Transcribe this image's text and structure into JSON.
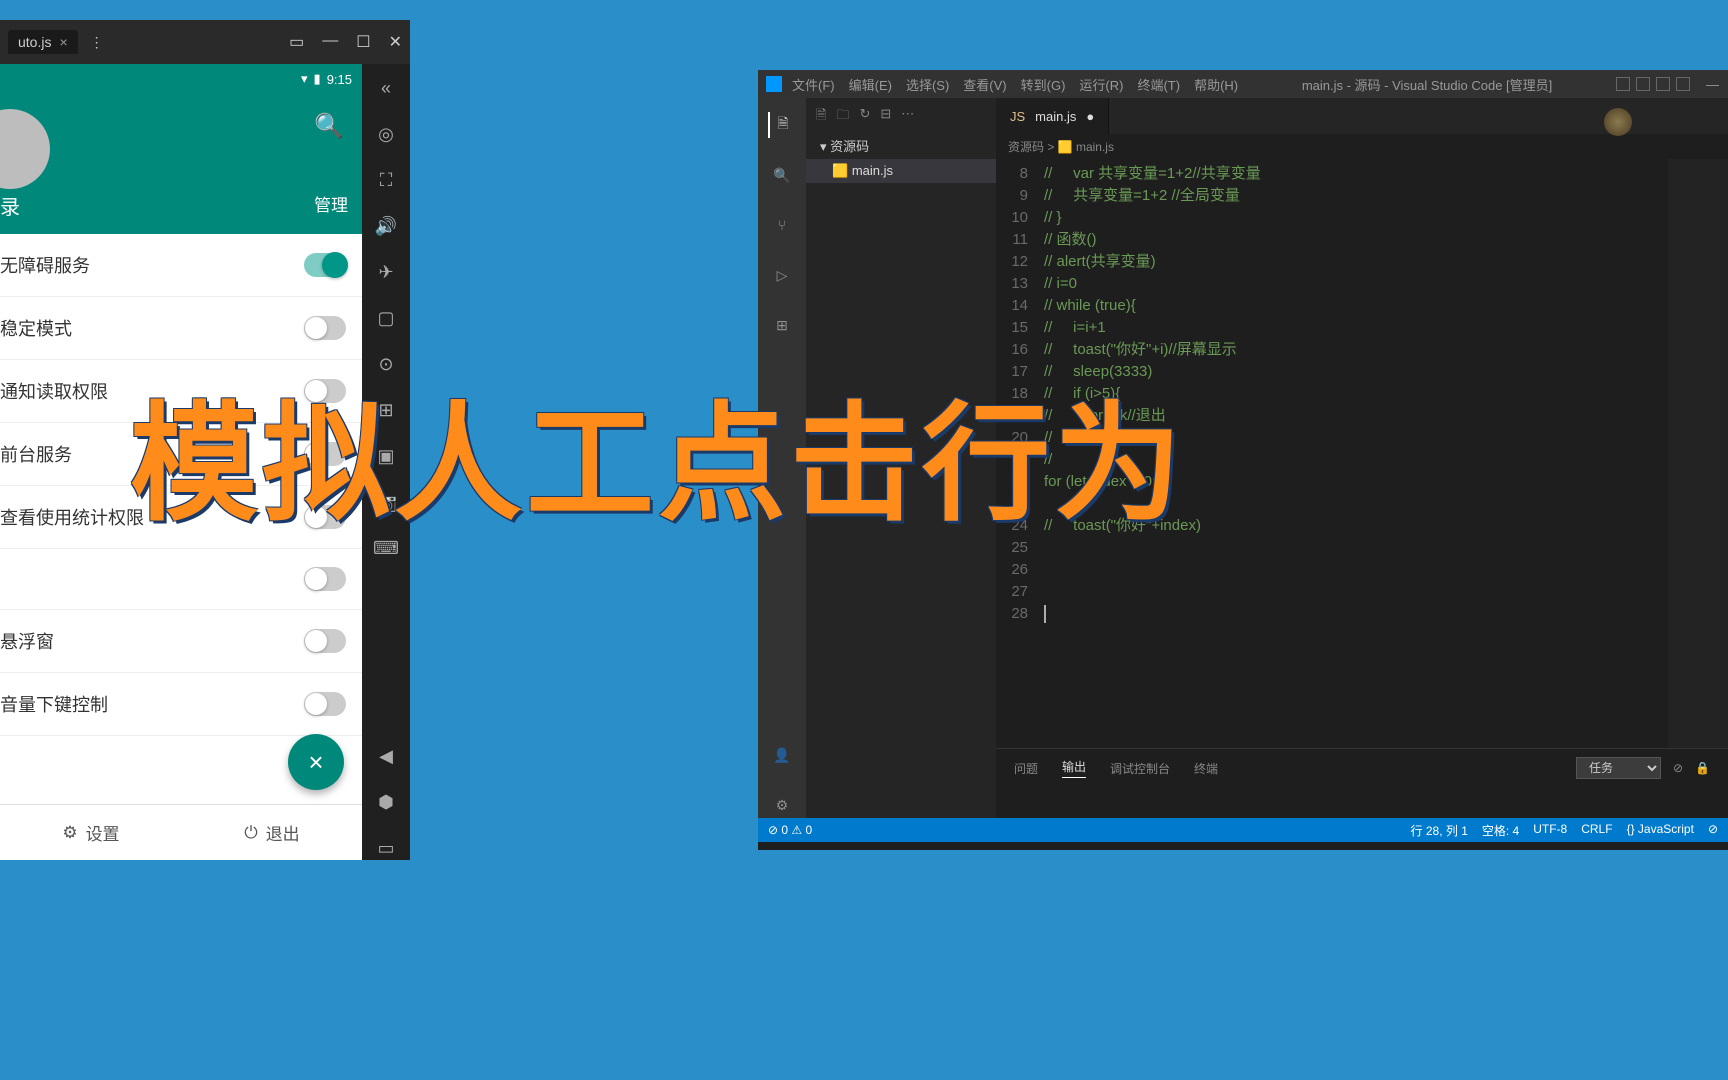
{
  "overlay_text": "模拟人工点击行为",
  "emu": {
    "tab_title": "uto.js",
    "status_time": "9:15",
    "header_login": "录",
    "header_manage": "管理",
    "rows": [
      {
        "label": "无障碍服务",
        "on": true
      },
      {
        "label": "稳定模式",
        "on": false
      },
      {
        "label": "通知读取权限",
        "on": false
      },
      {
        "label": "前台服务",
        "on": false
      },
      {
        "label": "查看使用统计权限",
        "on": false
      },
      {
        "label": "",
        "on": false
      },
      {
        "label": "悬浮窗",
        "on": false
      },
      {
        "label": "音量下键控制",
        "on": false
      }
    ],
    "bottom_settings": "设置",
    "bottom_exit": "退出"
  },
  "vscode": {
    "menus": [
      "文件(F)",
      "编辑(E)",
      "选择(S)",
      "查看(V)",
      "转到(G)",
      "运行(R)",
      "终端(T)",
      "帮助(H)"
    ],
    "window_title": "main.js - 源码 - Visual Studio Code [管理员]",
    "explorer_folder": "资源码",
    "explorer_file": "main.js",
    "tab_file": "main.js",
    "breadcrumb": "资源码 > 🟨 main.js",
    "code_lines": [
      {
        "n": 8,
        "t": "//     var 共享变量=1+2//共享变量"
      },
      {
        "n": 9,
        "t": "//     共享变量=1+2 //全局变量"
      },
      {
        "n": 10,
        "t": "// }"
      },
      {
        "n": 11,
        "t": "// 函数()"
      },
      {
        "n": 12,
        "t": "// alert(共享变量)"
      },
      {
        "n": 13,
        "t": "// i=0"
      },
      {
        "n": 14,
        "t": "// while (true){"
      },
      {
        "n": 15,
        "t": "//     i=i+1"
      },
      {
        "n": 16,
        "t": "//     toast(\"你好\"+i)//屏幕显示"
      },
      {
        "n": 17,
        "t": "//     sleep(3333)"
      },
      {
        "n": 18,
        "t": "//     if (i>5){"
      },
      {
        "n": 19,
        "t": "//         break//退出"
      },
      {
        "n": 20,
        "t": "// "
      },
      {
        "n": 21,
        "t": "// "
      },
      {
        "n": 22,
        "t": "for (let index = 0;"
      },
      {
        "n": 23,
        "t": ""
      },
      {
        "n": 24,
        "t": "//     toast(\"你好\"+index)"
      },
      {
        "n": 25,
        "t": ""
      },
      {
        "n": 26,
        "t": ""
      },
      {
        "n": 27,
        "t": ""
      },
      {
        "n": 28,
        "t": "",
        "cursor": true
      }
    ],
    "panel_tabs": [
      "问题",
      "输出",
      "调试控制台",
      "终端"
    ],
    "panel_active": "输出",
    "panel_select": "任务",
    "status": {
      "left": "⊘ 0 ⚠ 0",
      "right": [
        "行 28, 列 1",
        "空格: 4",
        "UTF-8",
        "CRLF",
        "{} JavaScript",
        "⊘"
      ]
    }
  }
}
